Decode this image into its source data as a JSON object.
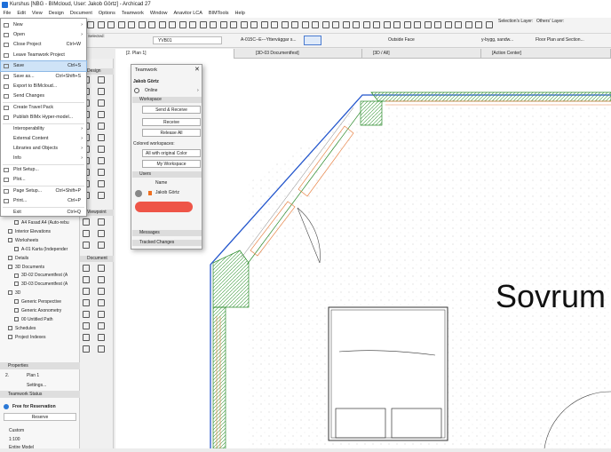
{
  "window": {
    "title": "Kurshus [NBG - BIMcloud, User: Jakob Görtz] - Archicad 27"
  },
  "menubar": [
    "File",
    "Edit",
    "View",
    "Design",
    "Document",
    "Options",
    "Teamwork",
    "Window",
    "Anavitor LCA",
    "BIMTools",
    "Help"
  ],
  "toolbar": {
    "selections_layer": "Selection's Layer:",
    "others_layer": "Others' Layer:",
    "layer_combo": "YVB01",
    "pen_set": "A-015C--E---Ytterväggar s...",
    "surface": "Outside Face",
    "fill": "y-bygg, sandw...",
    "model_view": "Floor Plan and Section...",
    "selected_label": "Selected:"
  },
  "tabs": [
    {
      "label": "[2. Plan 1]",
      "active": true
    },
    {
      "label": "[3D-03 Documentfest]",
      "active": false
    },
    {
      "label": "[3D / All]",
      "active": false
    },
    {
      "label": "[Action Center]",
      "active": false
    }
  ],
  "file_menu": [
    {
      "label": "New",
      "shortcut": "",
      "arrow": true,
      "icon": true
    },
    {
      "label": "Open",
      "shortcut": "",
      "arrow": true,
      "icon": true
    },
    {
      "label": "Close Project",
      "shortcut": "Ctrl+W",
      "arrow": false,
      "icon": true
    },
    {
      "label": "Leave Teamwork Project",
      "shortcut": "",
      "arrow": false,
      "icon": true
    },
    {
      "label": "Save",
      "shortcut": "Ctrl+S",
      "arrow": false,
      "icon": true,
      "selected": true
    },
    {
      "label": "Save as...",
      "shortcut": "Ctrl+Shift+S",
      "arrow": false,
      "icon": true
    },
    {
      "label": "Export to BIMcloud...",
      "shortcut": "",
      "arrow": false,
      "icon": true
    },
    {
      "label": "Send Changes",
      "shortcut": "",
      "arrow": false,
      "icon": true
    },
    {
      "label": "Create Travel Pack",
      "shortcut": "",
      "arrow": false,
      "icon": true
    },
    {
      "label": "Publish BIMx Hyper-model...",
      "shortcut": "",
      "arrow": false,
      "icon": true
    },
    {
      "label": "Interoperability",
      "shortcut": "",
      "arrow": true,
      "icon": false
    },
    {
      "label": "External Content",
      "shortcut": "",
      "arrow": true,
      "icon": false
    },
    {
      "label": "Libraries and Objects",
      "shortcut": "",
      "arrow": true,
      "icon": false
    },
    {
      "label": "Info",
      "shortcut": "",
      "arrow": true,
      "icon": false
    },
    {
      "label": "Plot Setup...",
      "shortcut": "",
      "arrow": false,
      "icon": true
    },
    {
      "label": "Plot...",
      "shortcut": "",
      "arrow": false,
      "icon": true
    },
    {
      "label": "Page Setup...",
      "shortcut": "Ctrl+Shift+P",
      "arrow": false,
      "icon": true
    },
    {
      "label": "Print...",
      "shortcut": "Ctrl+P",
      "arrow": false,
      "icon": true
    },
    {
      "label": "Exit",
      "shortcut": "Ctrl+Q",
      "arrow": false,
      "icon": false
    }
  ],
  "teamwork": {
    "title": "Teamwork",
    "user": "Jakob Görtz",
    "status": "Online",
    "workspace_header": "Workspace",
    "send_receive": "Send & Receive",
    "receive": "Receive",
    "release_all": "Release All",
    "colored_workspaces": "Colored workspaces:",
    "color_option": "All with original Color",
    "my_workspace": "My Workspace",
    "users_header": "Users",
    "name_col": "Name",
    "user_row": "Jakob Görtz",
    "messages": "Messages",
    "tracked_changes": "Tracked Changes"
  },
  "toolbox": {
    "design": "Design",
    "viewpoint": "Viewpoint",
    "document": "Document"
  },
  "navigator": [
    {
      "label": "A4 Fasad A4 (Auto-rebu",
      "indent": 2
    },
    {
      "label": "Interior Elevations",
      "indent": 1
    },
    {
      "label": "Worksheets",
      "indent": 1
    },
    {
      "label": "A-01 Karta (Independer",
      "indent": 2
    },
    {
      "label": "Details",
      "indent": 1
    },
    {
      "label": "3D Documents",
      "indent": 1
    },
    {
      "label": "3D-02 Documentfest (A",
      "indent": 2
    },
    {
      "label": "3D-03 Documentfest (A",
      "indent": 2
    },
    {
      "label": "3D",
      "indent": 1
    },
    {
      "label": "Generic Perspective",
      "indent": 2
    },
    {
      "label": "Generic Axonometry",
      "indent": 2
    },
    {
      "label": "00 Untitled Path",
      "indent": 2
    },
    {
      "label": "Schedules",
      "indent": 1
    },
    {
      "label": "Project Indexes",
      "indent": 1
    }
  ],
  "properties": {
    "header": "Properties",
    "id": "2.",
    "name": "Plan 1",
    "settings": "Settings..."
  },
  "teamwork_status": {
    "header": "Teamwork Status",
    "status": "Free for Reservation",
    "reserve": "Reserve"
  },
  "bottom": {
    "custom": "Custom",
    "scale": "1:100",
    "entire_model": "Entire Model"
  },
  "plan": {
    "room_label": "Sovrum"
  }
}
